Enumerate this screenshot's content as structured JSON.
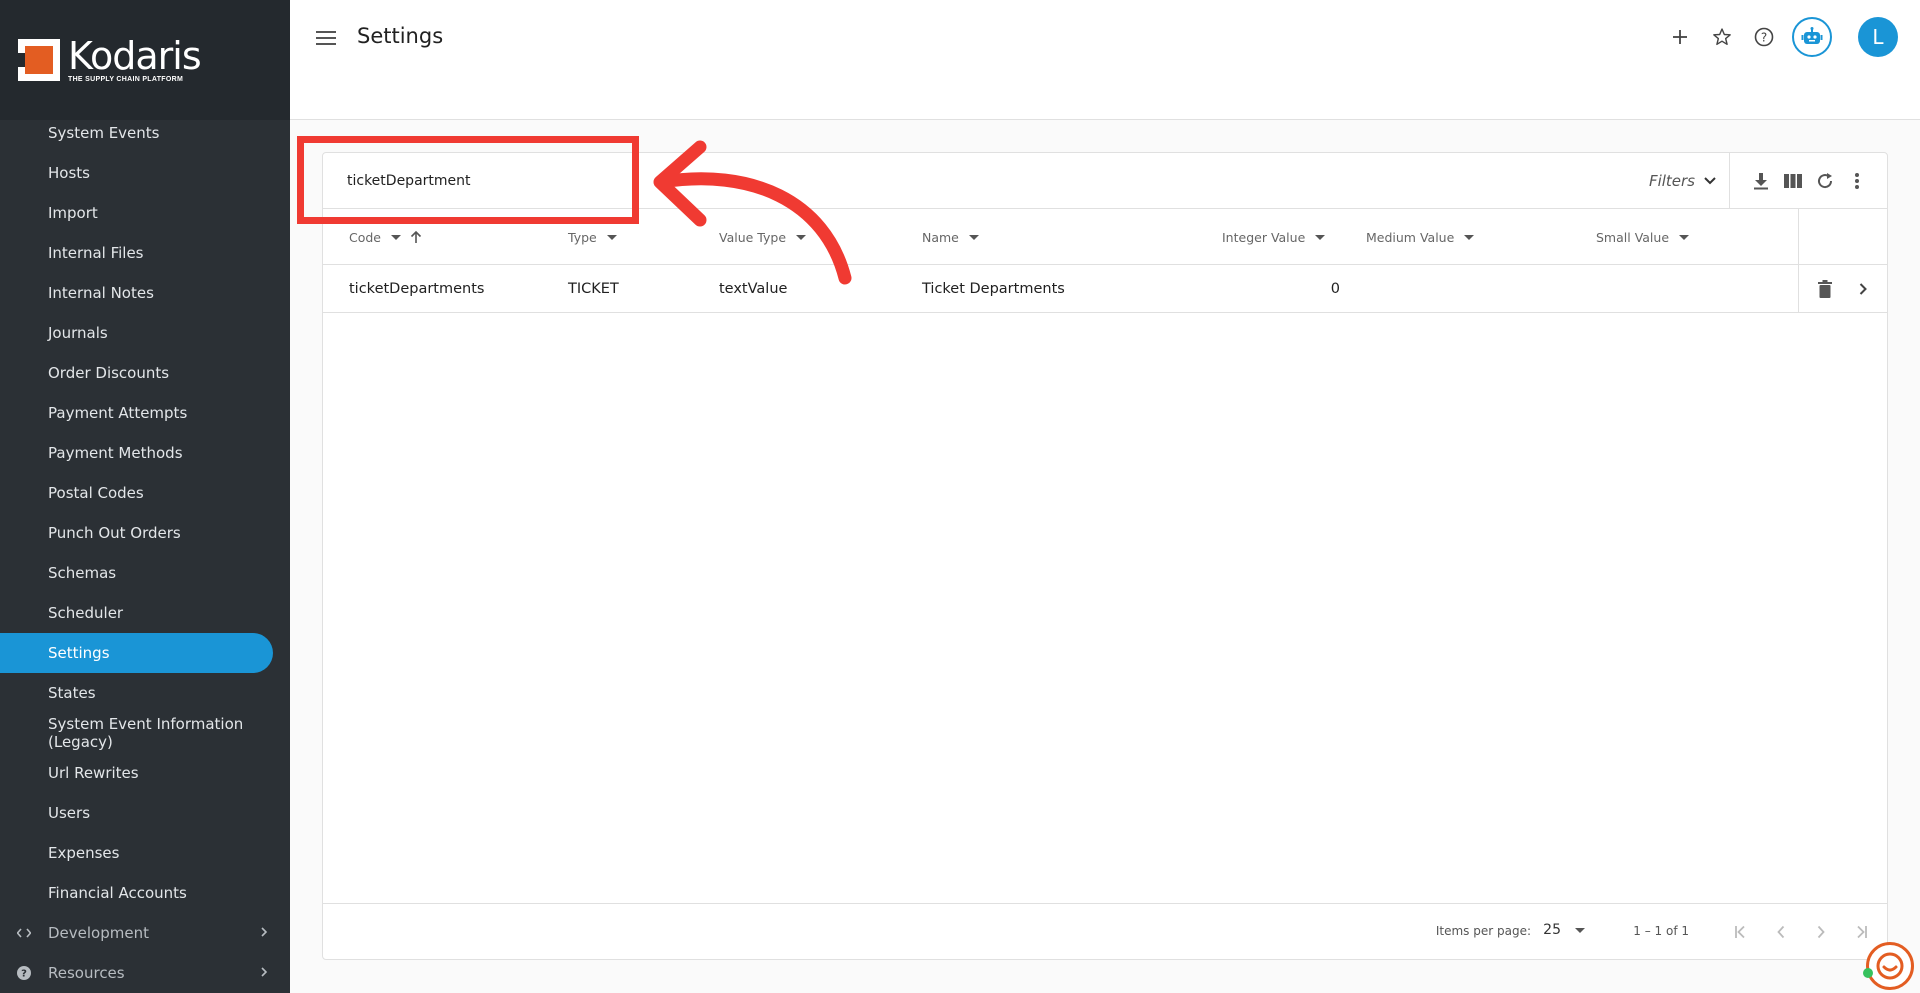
{
  "app": {
    "brand": "Kodaris",
    "tagline": "THE SUPPLY CHAIN PLATFORM",
    "accent": "#1a95d6",
    "sidebar_bg": "#2b3035"
  },
  "sidebar": {
    "items": [
      {
        "label": "System Events"
      },
      {
        "label": "Hosts"
      },
      {
        "label": "Import"
      },
      {
        "label": "Internal Files"
      },
      {
        "label": "Internal Notes"
      },
      {
        "label": "Journals"
      },
      {
        "label": "Order Discounts"
      },
      {
        "label": "Payment Attempts"
      },
      {
        "label": "Payment Methods"
      },
      {
        "label": "Postal Codes"
      },
      {
        "label": "Punch Out Orders"
      },
      {
        "label": "Schemas"
      },
      {
        "label": "Scheduler"
      },
      {
        "label": "Settings"
      },
      {
        "label": "States"
      },
      {
        "label": "System Event Information (Legacy)"
      },
      {
        "label": "Url Rewrites"
      },
      {
        "label": "Users"
      },
      {
        "label": "Expenses"
      },
      {
        "label": "Financial Accounts"
      }
    ],
    "groups": [
      {
        "label": "Development",
        "icon": "code-icon"
      },
      {
        "label": "Resources",
        "icon": "help-circle-icon"
      }
    ]
  },
  "header": {
    "title": "Settings",
    "avatar_initial": "L"
  },
  "search": {
    "value": "ticketDepartment"
  },
  "toolbar": {
    "filters_label": "Filters"
  },
  "table": {
    "columns": [
      {
        "label": "Code"
      },
      {
        "label": "Type"
      },
      {
        "label": "Value Type"
      },
      {
        "label": "Name"
      },
      {
        "label": "Integer Value"
      },
      {
        "label": "Medium Value"
      },
      {
        "label": "Small Value"
      }
    ],
    "rows": [
      {
        "code": "ticketDepartments",
        "type": "TICKET",
        "value_type": "textValue",
        "name": "Ticket Departments",
        "integer_value": "0",
        "medium_value": "",
        "small_value": ""
      }
    ]
  },
  "paginator": {
    "items_per_page_label": "Items per page:",
    "page_size": "25",
    "range": "1 – 1 of 1"
  }
}
